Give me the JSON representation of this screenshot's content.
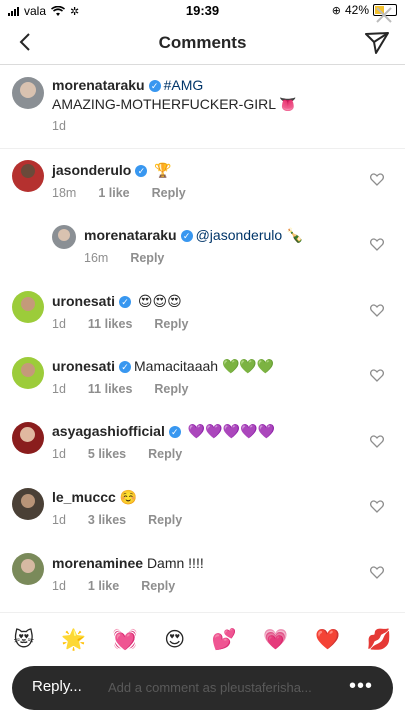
{
  "status": {
    "carrier": "vala",
    "time": "19:39",
    "battery": "42%"
  },
  "nav": {
    "title": "Comments"
  },
  "caption": {
    "username": "morenataraku",
    "hashtag": "#AMG",
    "text": "AMAZING-MOTHERFUCKER-GIRL",
    "emoji": "👅",
    "age": "1d"
  },
  "comments": [
    {
      "username": "jasonderulo",
      "verified": true,
      "text": "",
      "emoji": "🏆",
      "age": "18m",
      "likes": "1 like",
      "reply": "Reply",
      "avatar_color": "#b5312f"
    },
    {
      "username": "morenataraku",
      "verified": true,
      "text": "@jasonderulo",
      "emoji": "🍾",
      "age": "16m",
      "likes": "",
      "reply": "Reply",
      "avatar_color": "#8a8f94"
    },
    {
      "username": "uronesati",
      "verified": true,
      "text": "",
      "emoji": "😍😍😍",
      "age": "1d",
      "likes": "11 likes",
      "reply": "Reply",
      "avatar_color": "#9ccc3a"
    },
    {
      "username": "uronesati",
      "verified": true,
      "text": "Mamacitaaah",
      "emoji": "💚💚💚",
      "age": "1d",
      "likes": "11 likes",
      "reply": "Reply",
      "avatar_color": "#9ccc3a"
    },
    {
      "username": "asyagashiofficial",
      "verified": true,
      "text": "",
      "emoji": "💜💜💜💜💜",
      "age": "1d",
      "likes": "5 likes",
      "reply": "Reply",
      "avatar_color": "#8a1d1d"
    },
    {
      "username": "le_muccc",
      "verified": false,
      "text": "",
      "emoji": "☺️",
      "age": "1d",
      "likes": "3 likes",
      "reply": "Reply",
      "avatar_color": "#4a4036"
    },
    {
      "username": "morenaminee",
      "verified": false,
      "text": "Damn !!!!",
      "emoji": "",
      "age": "1d",
      "likes": "1 like",
      "reply": "Reply",
      "avatar_color": "#7a8a5a"
    }
  ],
  "emoji_bar": [
    "😻",
    "🌟",
    "💓",
    "😍",
    "💕",
    "💗",
    "❤️",
    "💋"
  ],
  "composer": {
    "label": "Reply...",
    "placeholder": "Add a comment as pleustaferisha...",
    "more": "•••"
  }
}
